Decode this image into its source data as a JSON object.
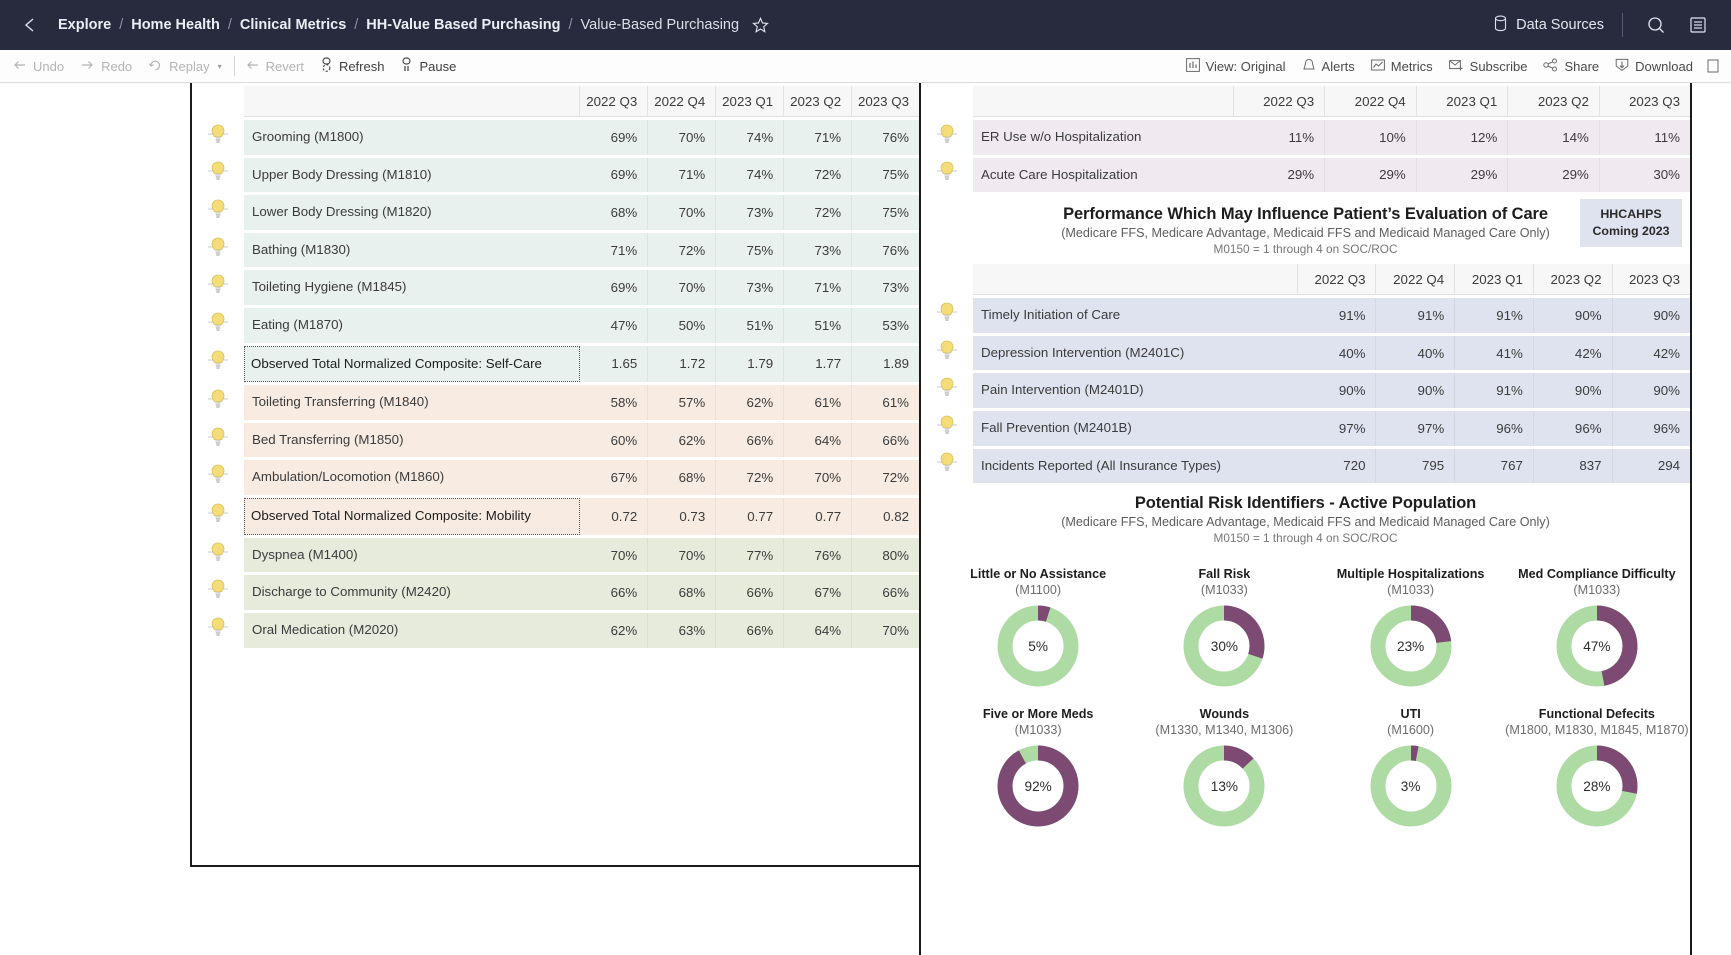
{
  "topbar": {
    "breadcrumbs": [
      "Explore",
      "Home Health",
      "Clinical Metrics",
      "HH-Value Based Purchasing",
      "Value-Based Purchasing"
    ],
    "separator": "/",
    "data_sources_label": "Data Sources",
    "icons": {
      "back": "back-arrow-icon",
      "star": "star-outline-icon",
      "database": "database-icon",
      "search": "search-icon",
      "menu": "hamburger-menu-icon"
    }
  },
  "toolbar": {
    "left": [
      {
        "label": "Undo",
        "icon": "undo-arrow-icon",
        "disabled": true
      },
      {
        "label": "Redo",
        "icon": "redo-arrow-icon",
        "disabled": true
      },
      {
        "label": "Replay",
        "icon": "replay-icon",
        "disabled": true
      }
    ],
    "caret": "▾",
    "revert": {
      "label": "Revert",
      "icon": "revert-arrow-icon",
      "disabled": true
    },
    "refresh": {
      "label": "Refresh",
      "icon": "refresh-icon",
      "disabled": false
    },
    "pause": {
      "label": "Pause",
      "icon": "pause-icon",
      "disabled": false
    },
    "right": [
      {
        "label": "View: Original",
        "icon": "bar-chart-icon"
      },
      {
        "label": "Alerts",
        "icon": "bell-icon"
      },
      {
        "label": "Metrics",
        "icon": "line-chart-icon"
      },
      {
        "label": "Subscribe",
        "icon": "envelope-plus-icon"
      },
      {
        "label": "Share",
        "icon": "share-nodes-icon"
      },
      {
        "label": "Download",
        "icon": "download-icon"
      }
    ]
  },
  "left_table": {
    "columns": [
      "",
      "2022 Q3",
      "2022 Q4",
      "2023 Q1",
      "2023 Q2",
      "2023 Q3"
    ],
    "rows": [
      {
        "group": "teal",
        "label": "Grooming (M1800)",
        "values": [
          "69%",
          "70%",
          "74%",
          "71%",
          "76%"
        ],
        "composite": false
      },
      {
        "group": "teal",
        "label": "Upper Body Dressing (M1810)",
        "values": [
          "69%",
          "71%",
          "74%",
          "72%",
          "75%"
        ],
        "composite": false
      },
      {
        "group": "teal",
        "label": "Lower Body Dressing (M1820)",
        "values": [
          "68%",
          "70%",
          "73%",
          "72%",
          "75%"
        ],
        "composite": false
      },
      {
        "group": "teal",
        "label": "Bathing (M1830)",
        "values": [
          "71%",
          "72%",
          "75%",
          "73%",
          "76%"
        ],
        "composite": false
      },
      {
        "group": "teal",
        "label": "Toileting Hygiene (M1845)",
        "values": [
          "69%",
          "70%",
          "73%",
          "71%",
          "73%"
        ],
        "composite": false
      },
      {
        "group": "teal",
        "label": "Eating (M1870)",
        "values": [
          "47%",
          "50%",
          "51%",
          "51%",
          "53%"
        ],
        "composite": false
      },
      {
        "group": "teal",
        "label": "Observed Total Normalized Composite: Self-Care",
        "values": [
          "1.65",
          "1.72",
          "1.79",
          "1.77",
          "1.89"
        ],
        "composite": true
      },
      {
        "group": "peach",
        "label": "Toileting Transferring (M1840)",
        "values": [
          "58%",
          "57%",
          "62%",
          "61%",
          "61%"
        ],
        "composite": false
      },
      {
        "group": "peach",
        "label": "Bed Transferring (M1850)",
        "values": [
          "60%",
          "62%",
          "66%",
          "64%",
          "66%"
        ],
        "composite": false
      },
      {
        "group": "peach",
        "label": "Ambulation/Locomotion (M1860)",
        "values": [
          "67%",
          "68%",
          "72%",
          "70%",
          "72%"
        ],
        "composite": false
      },
      {
        "group": "peach",
        "label": "Observed Total Normalized Composite: Mobility",
        "values": [
          "0.72",
          "0.73",
          "0.77",
          "0.77",
          "0.82"
        ],
        "composite": true
      },
      {
        "group": "olive",
        "label": "Dyspnea (M1400)",
        "values": [
          "70%",
          "70%",
          "77%",
          "76%",
          "80%"
        ],
        "composite": false
      },
      {
        "group": "olive",
        "label": "Discharge to Community (M2420)",
        "values": [
          "66%",
          "68%",
          "66%",
          "67%",
          "66%"
        ],
        "composite": false
      },
      {
        "group": "olive",
        "label": "Oral Medication (M2020)",
        "values": [
          "62%",
          "63%",
          "66%",
          "64%",
          "70%"
        ],
        "composite": false
      }
    ]
  },
  "right_table_top": {
    "columns": [
      "",
      "2022 Q3",
      "2022 Q4",
      "2023 Q1",
      "2023 Q2",
      "2023 Q3"
    ],
    "rows": [
      {
        "group": "lilac",
        "label": "ER Use w/o Hospitalization",
        "values": [
          "11%",
          "10%",
          "12%",
          "14%",
          "11%"
        ]
      },
      {
        "group": "lilac",
        "label": "Acute Care Hospitalization",
        "values": [
          "29%",
          "29%",
          "29%",
          "29%",
          "30%"
        ]
      }
    ]
  },
  "section_patient_eval": {
    "title": "Performance Which May Influence Patient’s Evaluation of Care",
    "subtitle": "(Medicare FFS, Medicare Advantage, Medicaid FFS and Medicaid Managed Care Only)",
    "note": "M0150 = 1 through 4 on SOC/ROC",
    "badge_line1": "HHCAHPS",
    "badge_line2": "Coming 2023"
  },
  "right_table_bottom": {
    "columns": [
      "",
      "2022 Q3",
      "2022 Q4",
      "2023 Q1",
      "2023 Q2",
      "2023 Q3"
    ],
    "rows": [
      {
        "group": "blue",
        "label": "Timely Initiation of Care",
        "values": [
          "91%",
          "91%",
          "91%",
          "90%",
          "90%"
        ]
      },
      {
        "group": "blue",
        "label": "Depression Intervention (M2401C)",
        "values": [
          "40%",
          "40%",
          "41%",
          "42%",
          "42%"
        ]
      },
      {
        "group": "blue",
        "label": "Pain Intervention (M2401D)",
        "values": [
          "90%",
          "90%",
          "91%",
          "90%",
          "90%"
        ]
      },
      {
        "group": "blue",
        "label": "Fall Prevention (M2401B)",
        "values": [
          "97%",
          "97%",
          "96%",
          "96%",
          "96%"
        ]
      },
      {
        "group": "blue",
        "label": "Incidents Reported (All Insurance Types)",
        "values": [
          "720",
          "795",
          "767",
          "837",
          "294"
        ]
      }
    ]
  },
  "section_risk": {
    "title": "Potential Risk Identifiers - Active Population",
    "subtitle": "(Medicare FFS, Medicare Advantage, Medicaid FFS and Medicaid Managed Care Only)",
    "note": "M0150 = 1 through 4 on SOC/ROC"
  },
  "chart_data": {
    "type": "pie",
    "title": "Potential Risk Identifiers - Active Population",
    "legend_position": "none",
    "colors": {
      "filled": "#7d4a74",
      "remainder": "#aedba4"
    },
    "donuts": [
      {
        "name": "Little or No Assistance",
        "code": "(M1100)",
        "value": 5,
        "label": "5%",
        "row": 1,
        "col": 1
      },
      {
        "name": "Fall Risk",
        "code": "(M1033)",
        "value": 30,
        "label": "30%",
        "row": 1,
        "col": 2
      },
      {
        "name": "Multiple Hospitalizations",
        "code": "(M1033)",
        "value": 23,
        "label": "23%",
        "row": 1,
        "col": 3
      },
      {
        "name": "Med Compliance Difficulty",
        "code": "(M1033)",
        "value": 47,
        "label": "47%",
        "row": 1,
        "col": 4
      },
      {
        "name": "Five or More Meds",
        "code": "(M1033)",
        "value": 92,
        "label": "92%",
        "row": 2,
        "col": 1
      },
      {
        "name": "Wounds",
        "code": "(M1330, M1340, M1306)",
        "value": 13,
        "label": "13%",
        "row": 2,
        "col": 2
      },
      {
        "name": "UTI",
        "code": "(M1600)",
        "value": 3,
        "label": "3%",
        "row": 2,
        "col": 3
      },
      {
        "name": "Functional Defecits",
        "code": "(M1800, M1830, M1845, M1870)",
        "value": 28,
        "label": "28%",
        "row": 2,
        "col": 4
      }
    ]
  }
}
